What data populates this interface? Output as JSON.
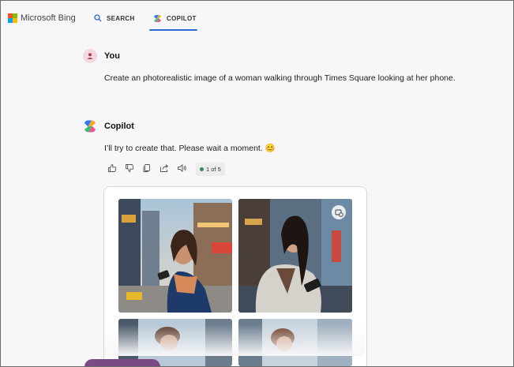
{
  "header": {
    "brand": "Microsoft Bing",
    "tabs": [
      {
        "label": "SEARCH",
        "icon": "search-icon"
      },
      {
        "label": "COPILOT",
        "icon": "copilot-icon",
        "active": true
      }
    ],
    "accent": "#2a6bd1"
  },
  "chat": {
    "user": {
      "name": "You",
      "message": "Create an photorealistic image of a woman walking through Times Square looking at her phone."
    },
    "copilot": {
      "name": "Copilot",
      "message": "I’ll try to create that. Please wait a moment. 😊",
      "actions": [
        "thumbs-up-icon",
        "thumbs-down-icon",
        "copy-icon",
        "share-icon",
        "read-aloud-icon"
      ],
      "counter": "1 of 5"
    },
    "images": [
      "woman-times-square-1",
      "woman-times-square-2",
      "woman-times-square-3",
      "woman-times-square-4"
    ]
  }
}
